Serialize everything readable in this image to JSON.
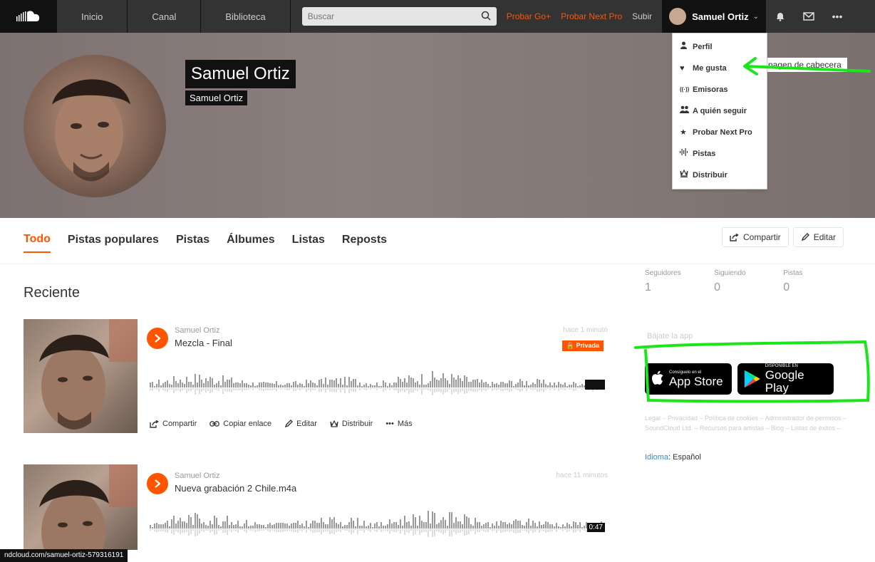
{
  "nav": {
    "links": [
      "Inicio",
      "Canal",
      "Biblioteca"
    ],
    "search_placeholder": "Buscar",
    "go_plus": "Probar Go+",
    "next_pro": "Probar Next Pro",
    "upload": "Subir",
    "user_name": "Samuel Ortiz",
    "more": "•••"
  },
  "header": {
    "name": "Samuel Ortiz",
    "subtitle": "Samuel Ortiz",
    "upload_header": "nagen de cabecera"
  },
  "dropdown": {
    "items": [
      {
        "icon": "person-icon",
        "glyph": "👤",
        "label": "Perfil"
      },
      {
        "icon": "heart-icon",
        "glyph": "♥",
        "label": "Me gusta"
      },
      {
        "icon": "stations-icon",
        "glyph": "((·))",
        "label": "Emisoras"
      },
      {
        "icon": "people-icon",
        "glyph": "👥",
        "label": "A quién seguir"
      },
      {
        "icon": "star-icon",
        "glyph": "★",
        "label": "Probar Next Pro"
      },
      {
        "icon": "waveform-icon",
        "glyph": "⫶",
        "label": "Pistas"
      },
      {
        "icon": "distribute-icon",
        "glyph": "♕",
        "label": "Distribuir"
      }
    ]
  },
  "tabs": [
    {
      "label": "Todo",
      "active": true
    },
    {
      "label": "Pistas populares",
      "active": false
    },
    {
      "label": "Pistas",
      "active": false
    },
    {
      "label": "Álbumes",
      "active": false
    },
    {
      "label": "Listas",
      "active": false
    },
    {
      "label": "Reposts",
      "active": false
    }
  ],
  "profile_actions": {
    "share": "Compartir",
    "edit": "Editar"
  },
  "section_title": "Reciente",
  "tracks": [
    {
      "user": "Samuel Ortiz",
      "title": "Mezcla - Final",
      "time": "hace 1 minuto",
      "private_label": "Privada",
      "duration": "",
      "actions": [
        "Compartir",
        "Copiar enlace",
        "Editar",
        "Distribuir",
        "Más"
      ]
    },
    {
      "user": "Samuel Ortiz",
      "title": "Nueva grabación 2 Chile.m4a",
      "time": "hace 11 minutos",
      "duration": "0:47"
    }
  ],
  "stats": [
    {
      "label": "Seguidores",
      "value": "1"
    },
    {
      "label": "Siguiendo",
      "value": "0"
    },
    {
      "label": "Pistas",
      "value": "0"
    }
  ],
  "sidebar": {
    "apps_title": "Bájate la app",
    "appstore_small": "Consíguelo en el",
    "appstore_big": "App Store",
    "googleplay_small": "DISPONIBLE EN",
    "googleplay_big": "Google Play",
    "footer": "Legal – Privacidad – Política de cookies – Administrador de permisos – SoundCloud Ltd. – Recursos para artistas – Blog – Listas de éxitos –",
    "language_label": "Idioma",
    "language_value": "Español"
  },
  "status_url": "ndcloud.com/samuel-ortiz-579316191",
  "colors": {
    "accent": "#ff5500",
    "annotation": "#00ff00",
    "topbar": "#333333"
  }
}
